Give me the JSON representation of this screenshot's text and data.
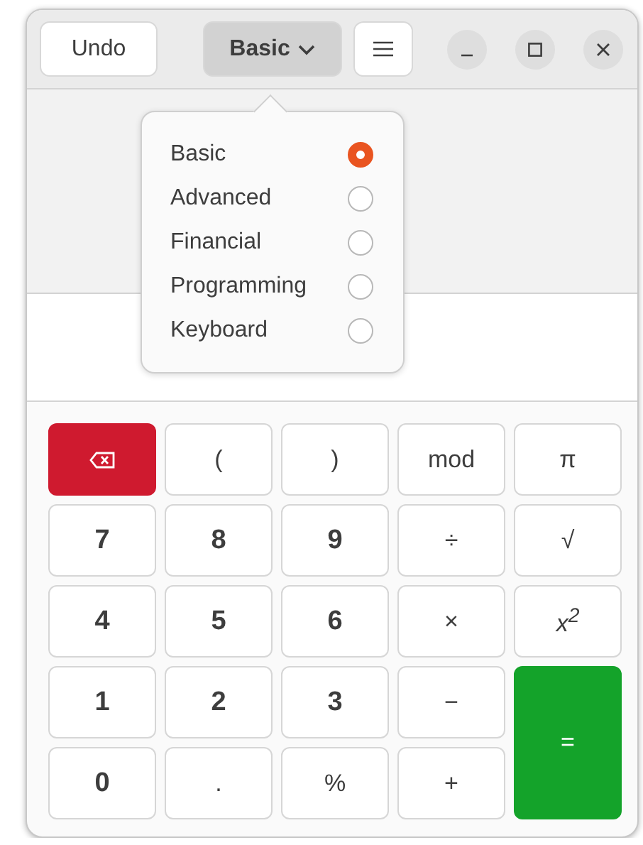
{
  "header": {
    "undo_button": "Undo",
    "mode_button": "Basic"
  },
  "mode_menu": {
    "items": [
      {
        "label": "Basic",
        "selected": true
      },
      {
        "label": "Advanced",
        "selected": false
      },
      {
        "label": "Financial",
        "selected": false
      },
      {
        "label": "Programming",
        "selected": false
      },
      {
        "label": "Keyboard",
        "selected": false
      }
    ]
  },
  "keypad": {
    "keys": [
      {
        "kind": "backspace"
      },
      {
        "kind": "function",
        "label": "("
      },
      {
        "kind": "function",
        "label": ")"
      },
      {
        "kind": "function",
        "label": "mod"
      },
      {
        "kind": "function",
        "label": "π"
      },
      {
        "kind": "digit",
        "label": "7"
      },
      {
        "kind": "digit",
        "label": "8"
      },
      {
        "kind": "digit",
        "label": "9"
      },
      {
        "kind": "function",
        "label": "÷"
      },
      {
        "kind": "function",
        "label": "√"
      },
      {
        "kind": "digit",
        "label": "4"
      },
      {
        "kind": "digit",
        "label": "5"
      },
      {
        "kind": "digit",
        "label": "6"
      },
      {
        "kind": "function",
        "label": "×"
      },
      {
        "kind": "italic",
        "label": "x$^{2}$"
      },
      {
        "kind": "digit",
        "label": "1"
      },
      {
        "kind": "digit",
        "label": "2"
      },
      {
        "kind": "digit",
        "label": "3"
      },
      {
        "kind": "function",
        "label": "−"
      },
      {
        "kind": "equals",
        "label": "="
      },
      {
        "kind": "digit",
        "label": "0"
      },
      {
        "kind": "function",
        "label": "."
      },
      {
        "kind": "function",
        "label": "%"
      },
      {
        "kind": "function",
        "label": "+"
      }
    ]
  }
}
